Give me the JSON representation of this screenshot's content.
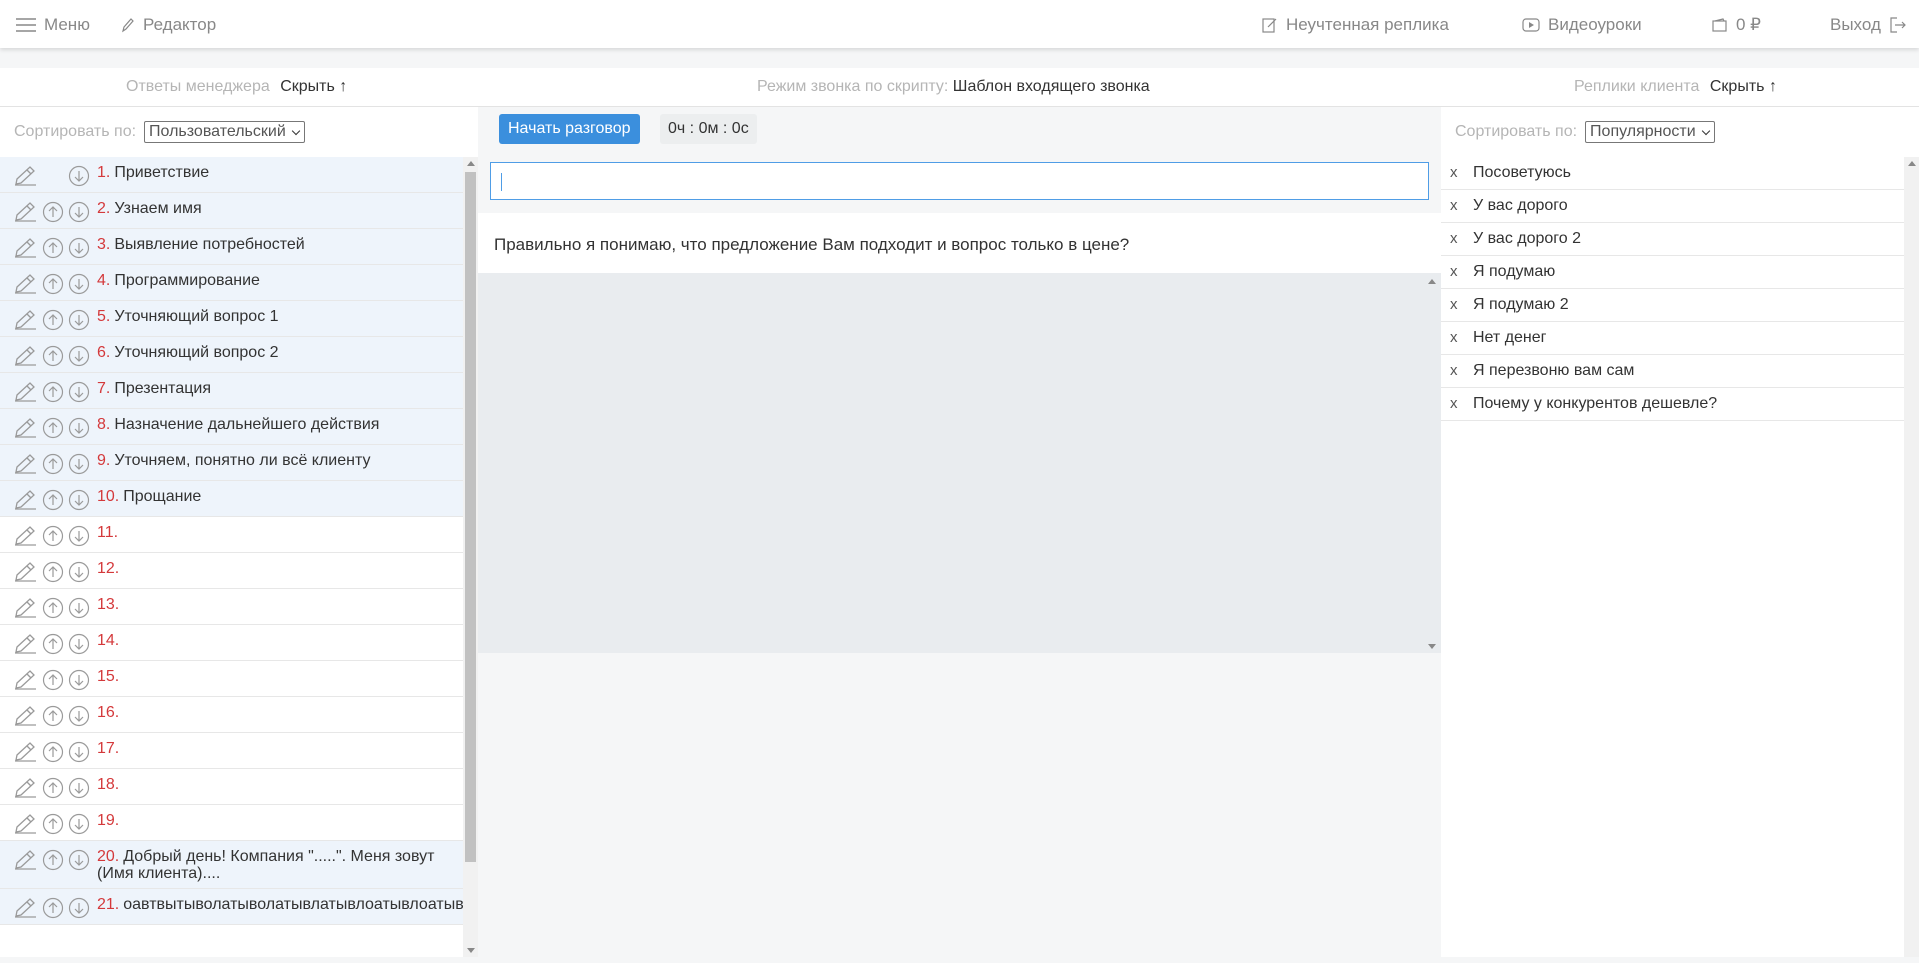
{
  "nav": {
    "menu_label": "Меню",
    "editor_label": "Редактор",
    "unaccounted_label": "Неучтенная реплика",
    "video_label": "Видеоуроки",
    "balance_label": "0 ₽",
    "exit_label": "Выход"
  },
  "header": {
    "manager_answers_label": "Ответы менеджера",
    "manager_hide_label": "Скрыть ↑",
    "mode_label": "Режим звонка по скрипту:",
    "mode_value": "Шаблон входящего звонка",
    "client_replies_label": "Реплики клиента",
    "client_hide_label": "Скрыть ↑"
  },
  "left": {
    "sort_label": "Сортировать по:",
    "sort_value": "Пользовательский",
    "items": [
      {
        "num": "1.",
        "text": "Приветствие"
      },
      {
        "num": "2.",
        "text": "Узнаем имя"
      },
      {
        "num": "3.",
        "text": "Выявление потребностей"
      },
      {
        "num": "4.",
        "text": "Программирование"
      },
      {
        "num": "5.",
        "text": "Уточняющий вопрос 1"
      },
      {
        "num": "6.",
        "text": "Уточняющий вопрос 2"
      },
      {
        "num": "7.",
        "text": "Презентация"
      },
      {
        "num": "8.",
        "text": "Назначение дальнейшего действия"
      },
      {
        "num": "9.",
        "text": "Уточняем, понятно ли всё клиенту"
      },
      {
        "num": "10.",
        "text": "Прощание"
      },
      {
        "num": "11.",
        "text": ""
      },
      {
        "num": "12.",
        "text": ""
      },
      {
        "num": "13.",
        "text": ""
      },
      {
        "num": "14.",
        "text": ""
      },
      {
        "num": "15.",
        "text": ""
      },
      {
        "num": "16.",
        "text": ""
      },
      {
        "num": "17.",
        "text": ""
      },
      {
        "num": "18.",
        "text": ""
      },
      {
        "num": "19.",
        "text": ""
      },
      {
        "num": "20.",
        "text": "Добрый день! Компания \".....\". Меня зовут (Имя клиента)...."
      },
      {
        "num": "21.",
        "text": "оавтвытыволатыволатывлатывлоатывлоатывало"
      }
    ]
  },
  "center": {
    "start_label": "Начать разговор",
    "timer": "0ч : 0м : 0с",
    "input_value": "",
    "phrase": "Правильно я понимаю, что предложение Вам подходит и вопрос только в цене?"
  },
  "right": {
    "sort_label": "Сортировать по:",
    "sort_value": "Популярности",
    "remove_label": "x",
    "items": [
      "Посоветуюсь",
      "У вас дорого",
      "У вас дорого 2",
      "Я подумаю",
      "Я подумаю 2",
      "Нет денег",
      "Я перезвоню вам сам",
      "Почему у конкурентов дешевле?"
    ]
  },
  "colors": {
    "accent": "#3b8fdd",
    "number_red": "#d4393b",
    "row_highlight": "#eef4fb"
  }
}
